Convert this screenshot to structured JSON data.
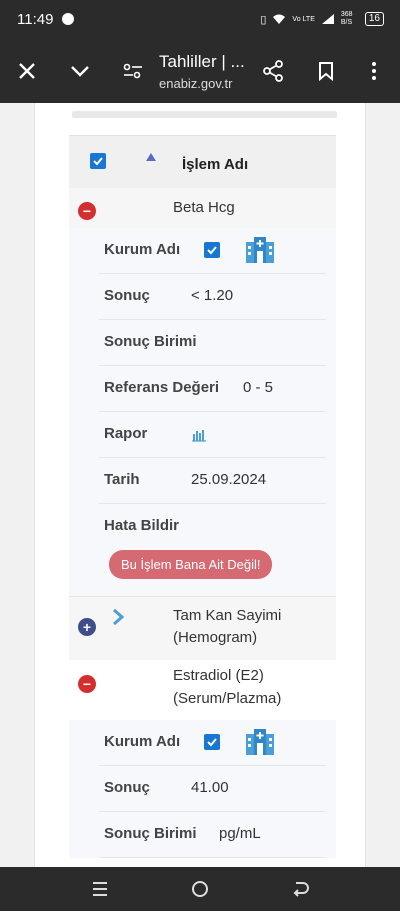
{
  "status": {
    "time": "11:49",
    "network": "Vo LTE",
    "speed": "368 B/S",
    "battery": "16"
  },
  "toolbar": {
    "title": "Tahliller | ...",
    "url": "enabiz.gov.tr"
  },
  "table": {
    "column_header": "İşlem Adı"
  },
  "labels": {
    "kurum": "Kurum Adı",
    "sonuc": "Sonuç",
    "birim": "Sonuç Birimi",
    "referans": "Referans Değeri",
    "rapor": "Rapor",
    "tarih": "Tarih",
    "hata": "Hata Bildir"
  },
  "error_button": "Bu İşlem Bana Ait Değil!",
  "tests": [
    {
      "name": "Beta Hcg",
      "sonuc": "< 1.20",
      "birim": "",
      "referans": "0 - 5",
      "tarih": "25.09.2024"
    },
    {
      "name_line1": "Tam Kan Sayimi",
      "name_line2": "(Hemogram)"
    },
    {
      "name_line1": "Estradiol (E2)",
      "name_line2": "(Serum/Plazma)",
      "sonuc": "41.00",
      "birim": "pg/mL"
    }
  ]
}
